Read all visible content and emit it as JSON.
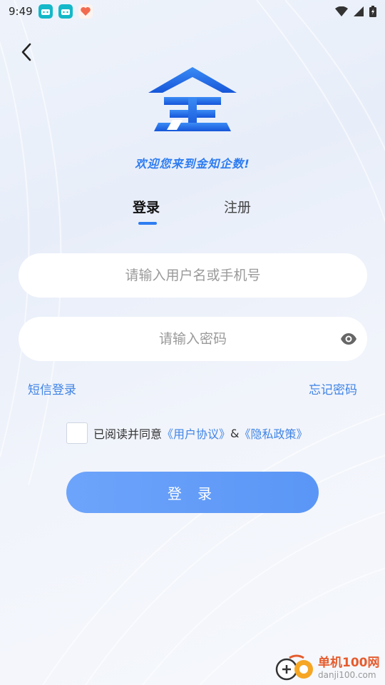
{
  "status_bar": {
    "time": "9:49"
  },
  "header": {
    "welcome": "欢迎您来到金知企数!"
  },
  "tabs": {
    "login": "登录",
    "register": "注册"
  },
  "form": {
    "username_placeholder": "请输入用户名或手机号",
    "password_placeholder": "请输入密码",
    "sms_login": "短信登录",
    "forgot_password": "忘记密码"
  },
  "agreement": {
    "prefix": "已阅读并同意",
    "user_agreement": "《用户协议》",
    "amp": "&",
    "privacy_policy": "《隐私政策》"
  },
  "login_button": "登 录",
  "watermark": {
    "cn": "单机100网",
    "en": "danji100.com"
  },
  "colors": {
    "accent": "#2d7cf1",
    "link": "#3f84e6",
    "button": "#6da4fb"
  }
}
